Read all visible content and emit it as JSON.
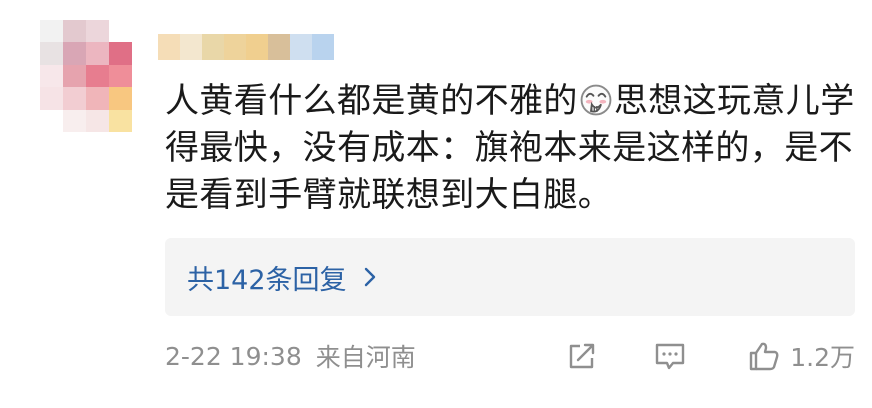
{
  "comment": {
    "text_before_emoji": "人黄看什么都是黄的不雅的",
    "emoji": "face-with-hand-over-mouth-emoji",
    "text_after_emoji": "思想这玩意儿学得最快，没有成本：旗袍本来是这样的，是不是看到手臂就联想到大白腿。"
  },
  "replies": {
    "label": "共142条回复",
    "chevron": "chevron-right-icon",
    "link_color": "#2c62a5"
  },
  "footer": {
    "datetime": "2-22 19:38",
    "location": "来自河南",
    "like_count": "1.2万",
    "icons": [
      "share-icon",
      "comment-icon",
      "like-icon"
    ]
  },
  "avatar": {
    "pixel_colors": [
      "#f2f2f2",
      "#e3c9cf",
      "#ecd6db",
      "#ffffff",
      "#e8e2e3",
      "#d9a6b5",
      "#ecb6c0",
      "#e06f86",
      "#f7e7ea",
      "#e6a3ae",
      "#e77d8f",
      "#ef8e99",
      "#f6e3e6",
      "#f2cdd2",
      "#f0b5b9",
      "#f8c780",
      "#ffffff",
      "#f8eeee",
      "#f6e6e6",
      "#f9e2a1"
    ]
  },
  "username": {
    "pixel_colors": [
      "#f5ddb7",
      "#f3e7cf",
      "#e9d7a8",
      "#eed39b",
      "#f0cf8f",
      "#d8bf9a",
      "#cfdff0",
      "#b9d3ee"
    ]
  }
}
